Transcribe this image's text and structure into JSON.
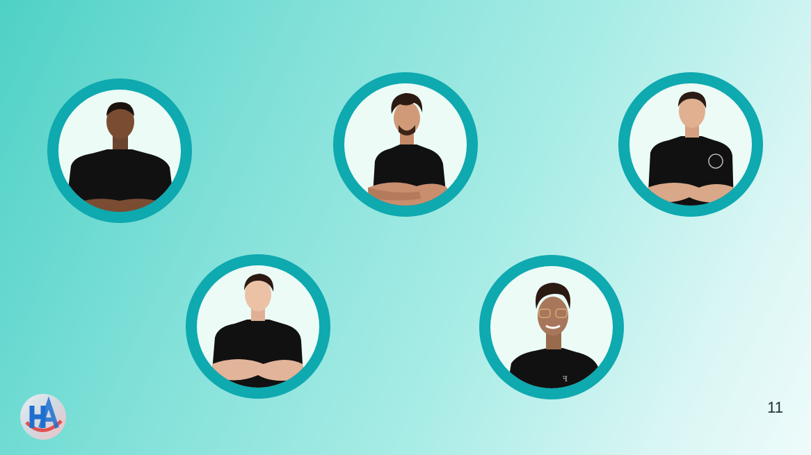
{
  "slide": {
    "page_number": "11",
    "team_photos": [
      {
        "icon": "person-portrait-icon"
      },
      {
        "icon": "person-portrait-icon"
      },
      {
        "icon": "person-portrait-icon"
      },
      {
        "icon": "person-portrait-icon"
      },
      {
        "icon": "person-portrait-icon"
      }
    ],
    "logo": {
      "icon": "ha-logo-icon",
      "text": "HA"
    }
  },
  "colors": {
    "ring": "#0fa9b0",
    "photo_background": "#ecfbf6",
    "shirt": "#111111",
    "background_start": "#4fd1c6",
    "background_end": "#eefbfb"
  }
}
